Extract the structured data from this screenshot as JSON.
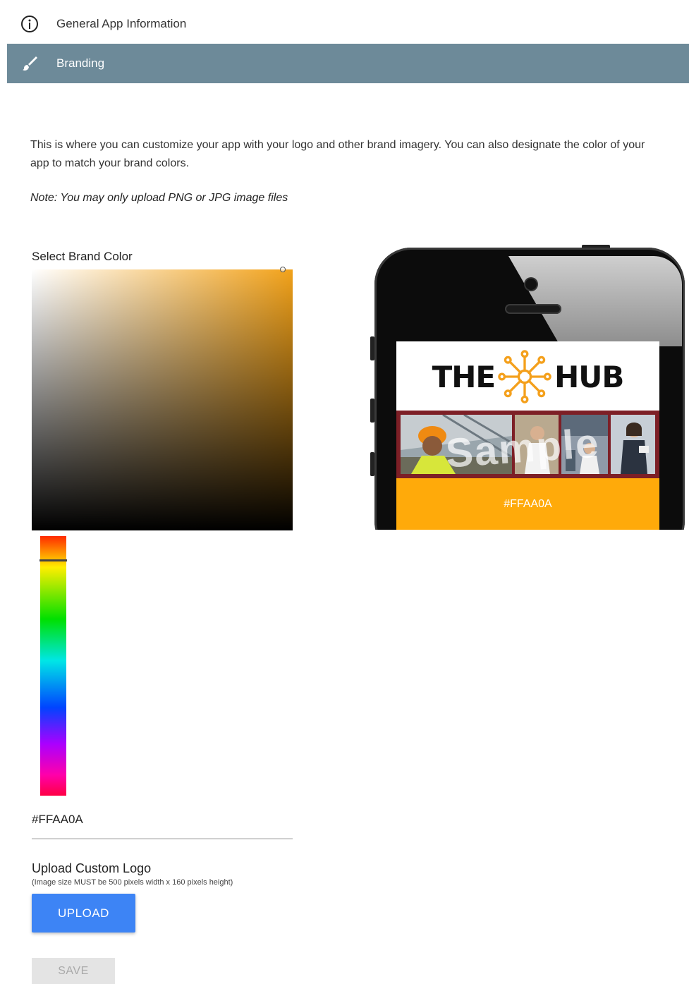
{
  "nav": {
    "general_label": "General App Information",
    "branding_label": "Branding"
  },
  "content": {
    "description": "This is where you can customize your app with your logo and other brand imagery. You can also designate the color of your app to match your brand colors.",
    "note": "Note: You may only upload PNG or JPG image files"
  },
  "color_picker": {
    "label": "Select Brand Color",
    "hex_value": "#FFAA0A",
    "hue_level": 0.09
  },
  "upload": {
    "label": "Upload Custom Logo",
    "note": "(Image size MUST be 500 pixels width x 160 pixels height)",
    "button_label": "UPLOAD"
  },
  "save": {
    "button_label": "SAVE"
  },
  "preview": {
    "logo_left": "THE",
    "logo_right": "HUB",
    "watermark": "Sample",
    "brand_color": "#FFAA0A",
    "brand_color_label": "#FFAA0A"
  },
  "icons": {
    "general": "info-icon",
    "branding": "brush-icon",
    "logo": "hub-network-icon"
  }
}
